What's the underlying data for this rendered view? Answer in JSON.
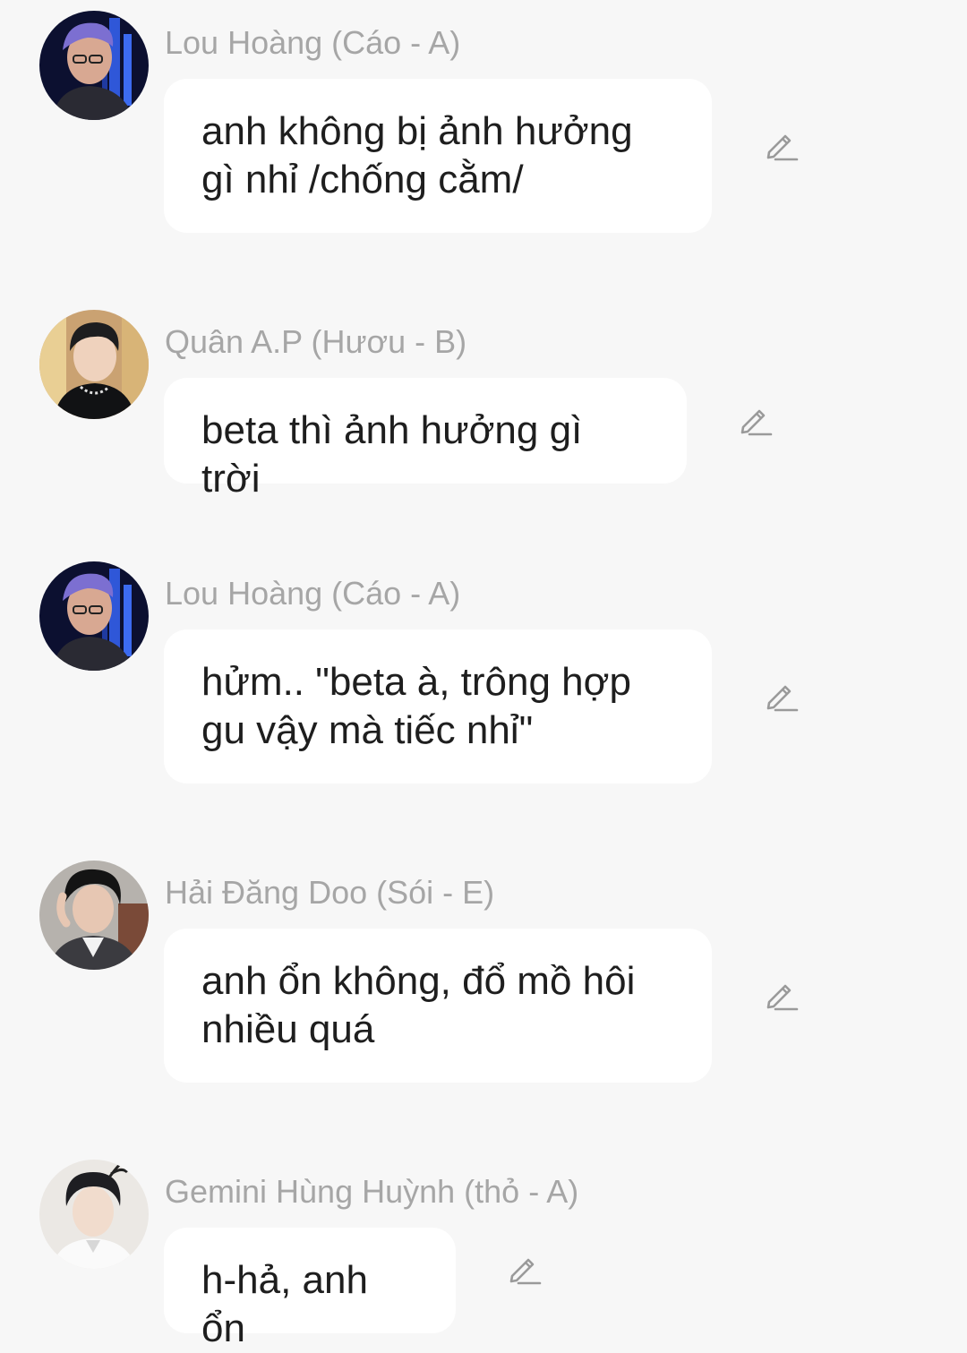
{
  "messages": [
    {
      "sender": "Lou Hoàng (Cáo - A)",
      "text": "anh không bị ảnh hưởng gì nhỉ /chống cằm/",
      "avatar_icon": "avatar-lou-hoang",
      "edit_icon": "edit-pencil-icon"
    },
    {
      "sender": "Quân A.P (Hươu - B)",
      "text": "beta thì ảnh hưởng gì trời",
      "avatar_icon": "avatar-quan-ap",
      "edit_icon": "edit-pencil-icon"
    },
    {
      "sender": "Lou Hoàng (Cáo - A)",
      "text": "hửm.. \"beta à, trông hợp gu vậy mà tiếc nhỉ\"",
      "avatar_icon": "avatar-lou-hoang",
      "edit_icon": "edit-pencil-icon"
    },
    {
      "sender": "Hải Đăng Doo (Sói - E)",
      "text": "anh ổn không, đổ mồ hôi nhiều quá",
      "avatar_icon": "avatar-hai-dang-doo",
      "edit_icon": "edit-pencil-icon"
    },
    {
      "sender": "Gemini Hùng Huỳnh (thỏ - A)",
      "text": "h-hả, anh ổn",
      "avatar_icon": "avatar-gemini-hung-huynh",
      "edit_icon": "edit-pencil-icon"
    }
  ],
  "colors": {
    "background": "#f7f7f7",
    "bubble": "#ffffff",
    "sender_name": "#a6a6a6",
    "message_text": "#1e1e1e",
    "edit_icon": "#9a9a9a"
  }
}
